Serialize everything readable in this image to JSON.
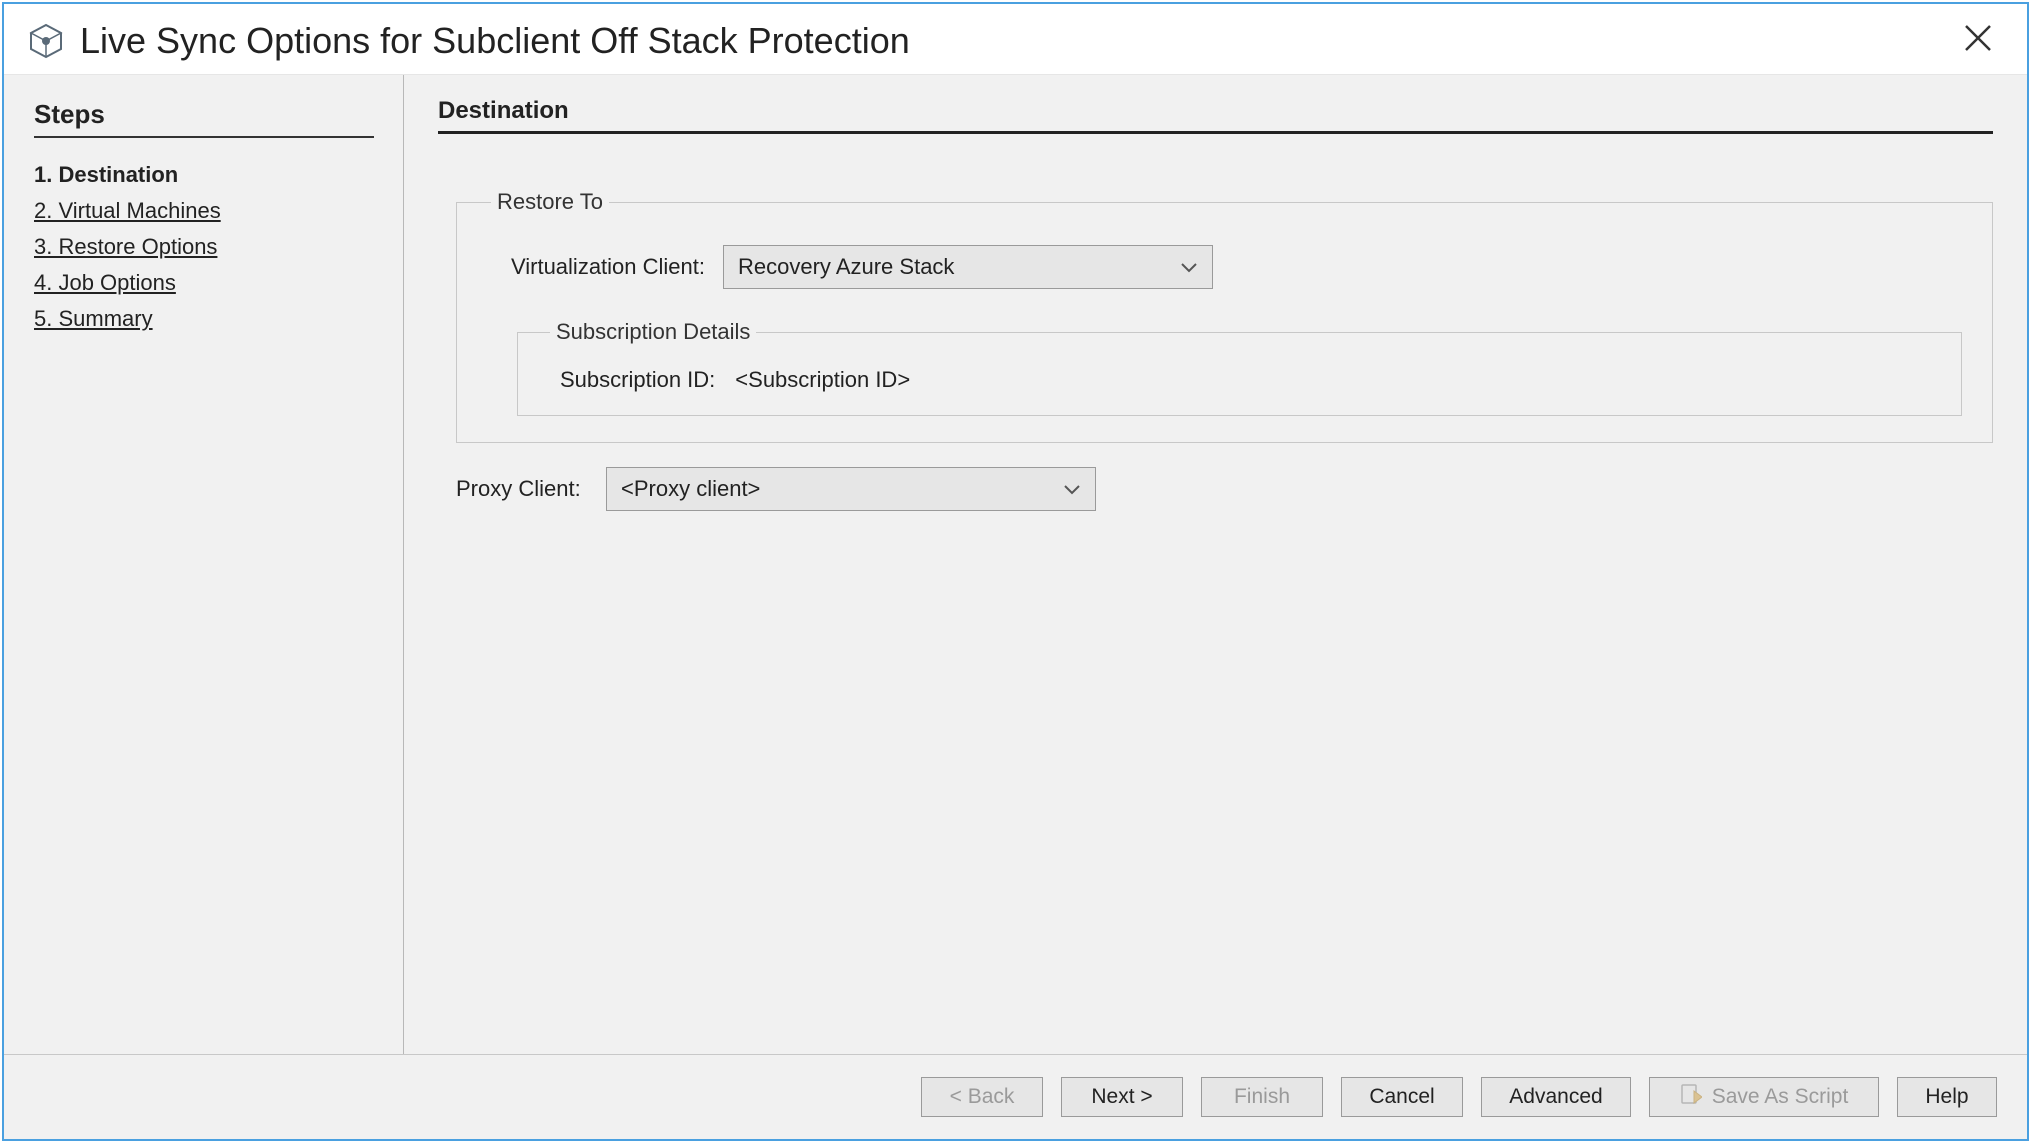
{
  "window": {
    "title": "Live Sync Options for Subclient Off Stack Protection"
  },
  "sidebar": {
    "header": "Steps",
    "items": [
      {
        "label": "1. Destination",
        "active": true
      },
      {
        "label": "2. Virtual Machines",
        "active": false
      },
      {
        "label": "3. Restore Options",
        "active": false
      },
      {
        "label": "4. Job Options",
        "active": false
      },
      {
        "label": "5. Summary",
        "active": false
      }
    ]
  },
  "main": {
    "section_title": "Destination",
    "restore_to": {
      "legend": "Restore To",
      "virt_client_label": "Virtualization Client:",
      "virt_client_value": "Recovery Azure Stack",
      "subscription": {
        "legend": "Subscription Details",
        "id_label": "Subscription ID:",
        "id_value": "<Subscription ID>"
      }
    },
    "proxy": {
      "label": "Proxy Client:",
      "value": "<Proxy client>"
    }
  },
  "footer": {
    "back": "< Back",
    "next": "Next >",
    "finish": "Finish",
    "cancel": "Cancel",
    "advanced": "Advanced",
    "save_script": "Save As Script",
    "help": "Help"
  }
}
